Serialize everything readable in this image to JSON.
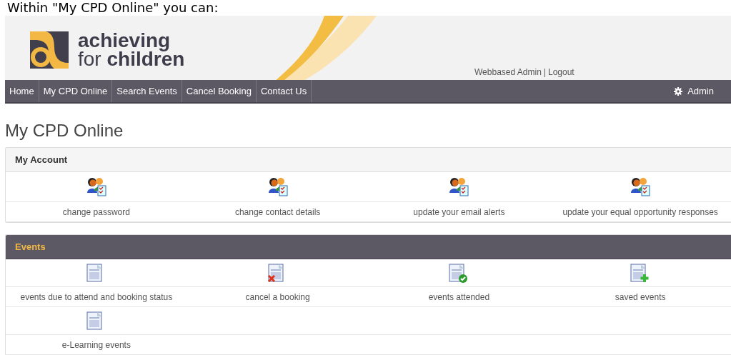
{
  "intro": "Within \"My CPD Online\" you can:",
  "header": {
    "logo_line1": "achieving",
    "logo_line2": "for **children**",
    "user": "Webbased Admin",
    "separator": "|",
    "logout": "Logout"
  },
  "nav": {
    "items": [
      {
        "label": "Home",
        "selected": false
      },
      {
        "label": "My CPD Online",
        "selected": false
      },
      {
        "label": "Search Events",
        "selected": false
      },
      {
        "label": "Cancel Booking",
        "selected": false
      },
      {
        "label": "Contact Us",
        "selected": false
      }
    ],
    "admin": "Admin"
  },
  "page_title": "My CPD Online",
  "panels": [
    {
      "title": "My Account",
      "kind": "account",
      "items": [
        {
          "kind": "people",
          "label": "change password"
        },
        {
          "kind": "people",
          "label": "change contact details"
        },
        {
          "kind": "people",
          "label": "update your email alerts"
        },
        {
          "kind": "people",
          "label": "update your equal opportunity responses"
        }
      ]
    },
    {
      "title": "Events",
      "kind": "events",
      "items": [
        {
          "kind": "doc",
          "label": "events due to attend and booking status"
        },
        {
          "kind": "doc-cancel",
          "label": "cancel a booking"
        },
        {
          "kind": "doc-check",
          "label": "events attended"
        },
        {
          "kind": "doc-add",
          "label": "saved events"
        },
        {
          "kind": "doc",
          "label": "e-Learning events"
        }
      ]
    }
  ]
}
